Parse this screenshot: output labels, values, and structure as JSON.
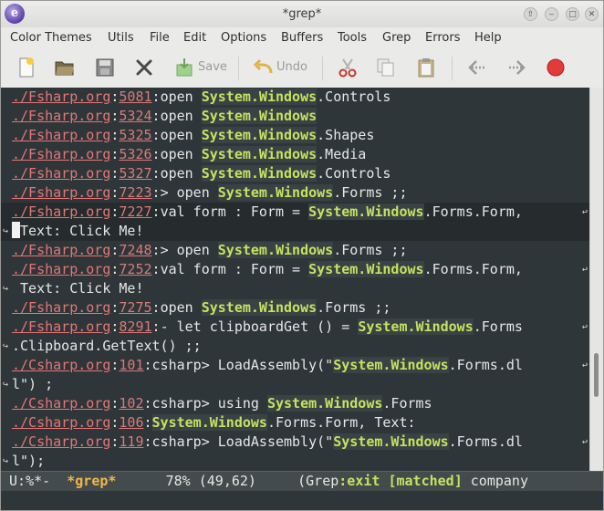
{
  "window": {
    "title": "*grep*",
    "app_icon_glyph": "e",
    "buttons": {
      "up": "⇧",
      "minimize": "‒",
      "maximize": "□",
      "close": "✕"
    }
  },
  "menubar": {
    "items": [
      "Color Themes",
      "Utils",
      "File",
      "Edit",
      "Options",
      "Buffers",
      "Tools",
      "Grep",
      "Errors",
      "Help"
    ]
  },
  "toolbar": {
    "new_icon": "new-file-icon",
    "open_icon": "open-folder-icon",
    "save_disk_icon": "disk-icon",
    "close_icon": "close-icon",
    "save_label": "Save",
    "undo_label": "Undo",
    "cut_icon": "scissors-icon",
    "copy_icon": "copy-icon",
    "paste_icon": "paste-icon",
    "back_icon": "back-icon",
    "forward_icon": "forward-icon",
    "stop_icon": "stop-icon"
  },
  "colors": {
    "background": "#2f3639",
    "match": "#c5e35f",
    "file": "#e47676",
    "modeline_buffer": "#f0b64a"
  },
  "results": [
    {
      "file": "./Fsharp.org",
      "line": "5081",
      "pre": "open ",
      "match": "System.Windows",
      "post": ".Controls"
    },
    {
      "file": "./Fsharp.org",
      "line": "5324",
      "pre": "open ",
      "match": "System.Windows",
      "post": ""
    },
    {
      "file": "./Fsharp.org",
      "line": "5325",
      "pre": "open ",
      "match": "System.Windows",
      "post": ".Shapes"
    },
    {
      "file": "./Fsharp.org",
      "line": "5326",
      "pre": "open ",
      "match": "System.Windows",
      "post": ".Media"
    },
    {
      "file": "./Fsharp.org",
      "line": "5327",
      "pre": "open ",
      "match": "System.Windows",
      "post": ".Controls"
    },
    {
      "file": "./Fsharp.org",
      "line": "7223",
      "pre": "> open ",
      "match": "System.Windows",
      "post": ".Forms ;;"
    },
    {
      "file": "./Fsharp.org",
      "line": "7227",
      "pre": "val form : Form = ",
      "match": "System.Windows",
      "post": ".Forms.Form,",
      "cont": "Text: Click Me!"
    },
    {
      "file": "./Fsharp.org",
      "line": "7248",
      "pre": "> open ",
      "match": "System.Windows",
      "post": ".Forms ;;"
    },
    {
      "file": "./Fsharp.org",
      "line": "7252",
      "pre": "val form : Form = ",
      "match": "System.Windows",
      "post": ".Forms.Form,",
      "cont": " Text: Click Me!"
    },
    {
      "file": "./Fsharp.org",
      "line": "7275",
      "pre": "open ",
      "match": "System.Windows",
      "post": ".Forms ;;"
    },
    {
      "file": "./Fsharp.org",
      "line": "8291",
      "pre": "- let clipboardGet () = ",
      "match": "System.Windows",
      "post": ".Forms",
      "cont": ".Clipboard.GetText() ;;"
    },
    {
      "file": "./Csharp.org",
      "line": "101",
      "pre": "csharp> LoadAssembly(\"",
      "match": "System.Windows",
      "post": ".Forms.dl",
      "cont": "l\") ;"
    },
    {
      "file": "./Csharp.org",
      "line": "102",
      "pre": "csharp> using ",
      "match": "System.Windows",
      "post": ".Forms"
    },
    {
      "file": "./Csharp.org",
      "line": "106",
      "pre": "",
      "match": "System.Windows",
      "post": ".Forms.Form, Text:"
    },
    {
      "file": "./Csharp.org",
      "line": "119",
      "pre": "csharp> LoadAssembly(\"",
      "match": "System.Windows",
      "post": ".Forms.dl",
      "cont": "l\");"
    }
  ],
  "modeline": {
    "status": " U:%*-  ",
    "buffer": "*grep*",
    "position": "      78% (49,62)     (Grep",
    "exit": ":exit [matched]",
    "rest": " company"
  },
  "scrollbar": {
    "position_percent": 78
  }
}
